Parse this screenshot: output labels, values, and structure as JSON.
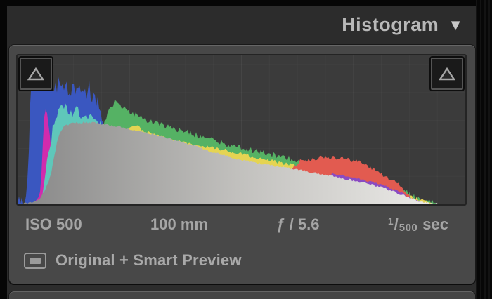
{
  "panel": {
    "title": "Histogram",
    "collapse_icon": "▼"
  },
  "exif": {
    "iso": "ISO 500",
    "focal_length": "100 mm",
    "aperture": "ƒ / 5.6",
    "shutter": {
      "numerator": "1",
      "denominator": "500",
      "unit": "sec"
    }
  },
  "status": {
    "preview_label": "Original + Smart Preview"
  },
  "colors": {
    "panel_bg": "#2c2c2c",
    "box_bg": "#484848",
    "chart_bg": "#3b3b3b",
    "title_text": "#b8b8b8",
    "exif_text": "#a5a5a5",
    "channel_blue": "#3a57c0",
    "channel_magenta": "#d12bad",
    "channel_cyan": "#5fc7ba",
    "channel_green": "#55b264",
    "channel_yellow": "#e5d452",
    "channel_red": "#e25b50",
    "channel_violet": "#8a4bc2",
    "luminance_gray_start": "#878787",
    "luminance_gray_end": "#f2f1ee"
  },
  "chart_data": {
    "type": "area",
    "title": "",
    "xlabel": "",
    "ylabel": "",
    "x_range": [
      0,
      255
    ],
    "y_range": [
      0,
      1
    ],
    "grid": {
      "divisions": 16,
      "on": true
    },
    "legend": "none",
    "series": [
      {
        "name": "blue",
        "color": "#3a57c0",
        "jitter": 0.05,
        "spike": 0.05,
        "points": [
          [
            0,
            0.01
          ],
          [
            4,
            0.02
          ],
          [
            5,
            0.06
          ],
          [
            6,
            0.25
          ],
          [
            7,
            0.6
          ],
          [
            8,
            0.8
          ],
          [
            10,
            0.85
          ],
          [
            13,
            0.8
          ],
          [
            15,
            0.83
          ],
          [
            20,
            0.78
          ],
          [
            26,
            0.8
          ],
          [
            31,
            0.76
          ],
          [
            36,
            0.78
          ],
          [
            41,
            0.74
          ],
          [
            45,
            0.7
          ],
          [
            48,
            0.6
          ],
          [
            51,
            0.45
          ],
          [
            54,
            0.25
          ],
          [
            55,
            0
          ]
        ]
      },
      {
        "name": "magenta",
        "color": "#d12bad",
        "jitter": 0.018,
        "points": [
          [
            10,
            0
          ],
          [
            12,
            0.04
          ],
          [
            13,
            0.1
          ],
          [
            14,
            0.3
          ],
          [
            15,
            0.55
          ],
          [
            16,
            0.65
          ],
          [
            17,
            0.6
          ],
          [
            18,
            0.5
          ],
          [
            19,
            0.38
          ],
          [
            20,
            0.25
          ],
          [
            21,
            0.15
          ],
          [
            22,
            0.08
          ],
          [
            24,
            0.03
          ],
          [
            26,
            0
          ]
        ]
      },
      {
        "name": "cyan",
        "color": "#5fc7ba",
        "jitter": 0.035,
        "points": [
          [
            13,
            0
          ],
          [
            15,
            0.1
          ],
          [
            17,
            0.3
          ],
          [
            20,
            0.5
          ],
          [
            23,
            0.62
          ],
          [
            27,
            0.66
          ],
          [
            31,
            0.6
          ],
          [
            34,
            0.63
          ],
          [
            38,
            0.58
          ],
          [
            42,
            0.6
          ],
          [
            46,
            0.55
          ],
          [
            50,
            0.52
          ],
          [
            54,
            0.47
          ],
          [
            56,
            0.4
          ],
          [
            59,
            0.25
          ],
          [
            61,
            0
          ]
        ]
      },
      {
        "name": "green",
        "color": "#55b264",
        "jitter": 0.02,
        "points": [
          [
            42,
            0
          ],
          [
            48,
            0.5
          ],
          [
            52,
            0.62
          ],
          [
            55,
            0.69
          ],
          [
            59,
            0.65
          ],
          [
            64,
            0.62
          ],
          [
            71,
            0.58
          ],
          [
            79,
            0.545
          ],
          [
            89,
            0.51
          ],
          [
            99,
            0.475
          ],
          [
            110,
            0.44
          ],
          [
            120,
            0.4
          ],
          [
            128,
            0.375
          ],
          [
            138,
            0.35
          ],
          [
            148,
            0.325
          ],
          [
            156,
            0.305
          ],
          [
            161,
            0.29
          ],
          [
            166,
            0.27
          ],
          [
            171,
            0.245
          ],
          [
            176,
            0.22
          ],
          [
            184,
            0.19
          ],
          [
            194,
            0.165
          ],
          [
            204,
            0.145
          ],
          [
            214,
            0.12
          ],
          [
            219,
            0.095
          ],
          [
            224,
            0.065
          ],
          [
            228,
            0.035
          ],
          [
            233,
            0.018
          ],
          [
            236,
            0.02
          ],
          [
            239,
            0
          ]
        ]
      },
      {
        "name": "yellow",
        "color": "#e5d452",
        "jitter": 0.012,
        "points": [
          [
            56,
            0
          ],
          [
            61,
            0.5
          ],
          [
            64,
            0.525
          ],
          [
            69,
            0.525
          ],
          [
            71,
            0.5
          ],
          [
            79,
            0.465
          ],
          [
            89,
            0.43
          ],
          [
            99,
            0.4
          ],
          [
            110,
            0.385
          ],
          [
            120,
            0.36
          ],
          [
            128,
            0.335
          ],
          [
            138,
            0.31
          ],
          [
            148,
            0.285
          ],
          [
            156,
            0.265
          ],
          [
            163,
            0.245
          ],
          [
            171,
            0.22
          ],
          [
            179,
            0.195
          ],
          [
            186,
            0.17
          ],
          [
            194,
            0.15
          ],
          [
            204,
            0.13
          ],
          [
            209,
            0.115
          ],
          [
            214,
            0.1
          ],
          [
            219,
            0.075
          ],
          [
            224,
            0.05
          ],
          [
            230,
            0.03
          ],
          [
            234,
            0.02
          ],
          [
            237,
            0
          ]
        ]
      },
      {
        "name": "red",
        "color": "#e25b50",
        "jitter": 0.014,
        "points": [
          [
            148,
            0
          ],
          [
            153,
            0.18
          ],
          [
            157,
            0.25
          ],
          [
            161,
            0.29
          ],
          [
            166,
            0.3
          ],
          [
            173,
            0.315
          ],
          [
            179,
            0.31
          ],
          [
            184,
            0.315
          ],
          [
            189,
            0.3
          ],
          [
            194,
            0.285
          ],
          [
            199,
            0.26
          ],
          [
            204,
            0.23
          ],
          [
            209,
            0.19
          ],
          [
            214,
            0.155
          ],
          [
            219,
            0.115
          ],
          [
            222,
            0.07
          ],
          [
            224,
            0.04
          ],
          [
            227,
            0.02
          ],
          [
            230,
            0.01
          ],
          [
            232,
            0
          ]
        ]
      },
      {
        "name": "violet",
        "color": "#8a4bc2",
        "jitter": 0.007,
        "points": [
          [
            172,
            0
          ],
          [
            179,
            0.208
          ],
          [
            191,
            0.178
          ],
          [
            199,
            0.158
          ],
          [
            207,
            0.133
          ],
          [
            214,
            0.1
          ],
          [
            219,
            0.075
          ],
          [
            223,
            0.05
          ],
          [
            226,
            0.028
          ],
          [
            230,
            0.014
          ],
          [
            233,
            0
          ]
        ]
      },
      {
        "name": "gray-luminance",
        "gradient": [
          "#878787",
          "#c2c1be",
          "#f2f1ee"
        ],
        "color": "#c2c1be",
        "jitter": 0.007,
        "points": [
          [
            0,
            0
          ],
          [
            8,
            0.01
          ],
          [
            12,
            0.03
          ],
          [
            15,
            0.08
          ],
          [
            17,
            0.13
          ],
          [
            19,
            0.2
          ],
          [
            21,
            0.33
          ],
          [
            23,
            0.45
          ],
          [
            26,
            0.52
          ],
          [
            31,
            0.545
          ],
          [
            38,
            0.55
          ],
          [
            46,
            0.545
          ],
          [
            54,
            0.53
          ],
          [
            64,
            0.505
          ],
          [
            77,
            0.47
          ],
          [
            89,
            0.43
          ],
          [
            102,
            0.39
          ],
          [
            110,
            0.355
          ],
          [
            120,
            0.32
          ],
          [
            128,
            0.295
          ],
          [
            140,
            0.27
          ],
          [
            153,
            0.245
          ],
          [
            166,
            0.22
          ],
          [
            179,
            0.19
          ],
          [
            191,
            0.16
          ],
          [
            199,
            0.14
          ],
          [
            207,
            0.115
          ],
          [
            214,
            0.085
          ],
          [
            222,
            0.05
          ],
          [
            227,
            0.028
          ],
          [
            232,
            0.014
          ],
          [
            236,
            0.008
          ],
          [
            240,
            0
          ]
        ]
      }
    ]
  }
}
